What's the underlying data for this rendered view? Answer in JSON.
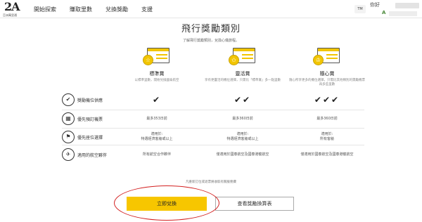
{
  "header": {
    "logo_text": "2A",
    "logo_sub": "亞洲萬里通",
    "nav": [
      "開始探索",
      "賺取里數",
      "兌換獎勵",
      "支援"
    ],
    "avatar_text": "TM",
    "greeting": "你好",
    "user_icon": "A"
  },
  "page": {
    "title": "飛行獎勵類別",
    "subtitle": "了解飛行獎勵類別，兌換心儀旅程。"
  },
  "tiers": [
    {
      "name": "標準賞",
      "desc": "以標準里數，開始兌換國泰航空",
      "icon": "star-icon",
      "symbol": "☆"
    },
    {
      "name": "靈活賞",
      "desc": "享有更靈活的機位選擇，只需比「標準賞」多一點里數",
      "icon": "stars-icon",
      "symbol": "✩"
    },
    {
      "name": "隨心賞",
      "desc": "隨心所享更多的機位選擇，只需比其他類別的獎勵機票再多些里數",
      "icon": "crown-icon",
      "symbol": "♔"
    }
  ],
  "rows": [
    {
      "icon": "check-circle-icon",
      "symbol": "✔",
      "label": "獎勵機位供應",
      "values": [
        "✔",
        "✔✔",
        "✔✔✔"
      ]
    },
    {
      "icon": "calendar-icon",
      "symbol": "▦",
      "label": "優先預訂機票",
      "values": [
        "最多353日前",
        "最多360日前",
        "最多360日前"
      ]
    },
    {
      "icon": "seat-icon",
      "symbol": "⚑",
      "label": "優先座位選擇",
      "values": [
        "適用於:\n特選經濟客艙或以上",
        "適用於:\n特選經濟客艙或以上",
        "適用於:\n所有客艙"
      ]
    },
    {
      "icon": "plane-icon",
      "symbol": "✈",
      "label": "適用的航空夥伴",
      "values": [
        "所有航空合作夥伴",
        "僅適用於國泰航空及國泰港龍航空",
        "僅適用於國泰航空及國泰港龍航空"
      ]
    }
  ],
  "note": "凡重新訂位或退票將收取有關服務費",
  "buttons": {
    "primary": "立即兌換",
    "secondary": "查看獎勵換算表"
  }
}
